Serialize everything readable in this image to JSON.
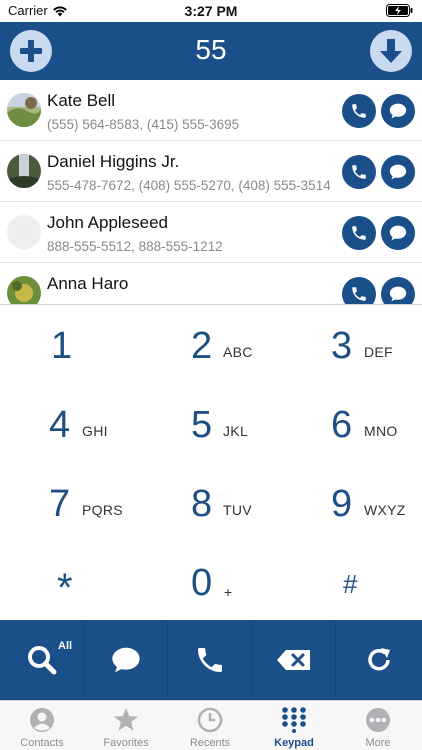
{
  "status_bar": {
    "carrier": "Carrier",
    "time": "3:27 PM"
  },
  "header": {
    "number": "55",
    "add_icon": "plus-icon",
    "download_icon": "arrow-down-icon"
  },
  "contacts": [
    {
      "name": "Kate Bell",
      "phones": "(555) 564-8583, (415) 555-3695"
    },
    {
      "name": "Daniel Higgins Jr.",
      "phones": "555-478-7672, (408) 555-5270, (408) 555-3514"
    },
    {
      "name": "John Appleseed",
      "phones": "888-555-5512, 888-555-1212"
    },
    {
      "name": "Anna Haro",
      "phones": ""
    }
  ],
  "keypad": [
    {
      "digit": "1",
      "letters": ""
    },
    {
      "digit": "2",
      "letters": "ABC"
    },
    {
      "digit": "3",
      "letters": "DEF"
    },
    {
      "digit": "4",
      "letters": "GHI"
    },
    {
      "digit": "5",
      "letters": "JKL"
    },
    {
      "digit": "6",
      "letters": "MNO"
    },
    {
      "digit": "7",
      "letters": "PQRS"
    },
    {
      "digit": "8",
      "letters": "TUV"
    },
    {
      "digit": "9",
      "letters": "WXYZ"
    },
    {
      "digit": "*",
      "letters": ""
    },
    {
      "digit": "0",
      "letters": "+"
    },
    {
      "digit": "#",
      "letters": ""
    }
  ],
  "action_bar": {
    "search_badge": "All",
    "icons": [
      "search-icon",
      "message-icon",
      "phone-icon",
      "backspace-icon",
      "refresh-icon"
    ]
  },
  "tabs": [
    {
      "label": "Contacts",
      "icon": "person-icon",
      "active": false
    },
    {
      "label": "Favorites",
      "icon": "star-icon",
      "active": false
    },
    {
      "label": "Recents",
      "icon": "clock-icon",
      "active": false
    },
    {
      "label": "Keypad",
      "icon": "keypad-icon",
      "active": true
    },
    {
      "label": "More",
      "icon": "more-icon",
      "active": false
    }
  ],
  "colors": {
    "primary": "#1a4f8a",
    "header_button": "#c9daf0",
    "digit": "#1e4f82",
    "tab_inactive": "#8e8e93"
  }
}
